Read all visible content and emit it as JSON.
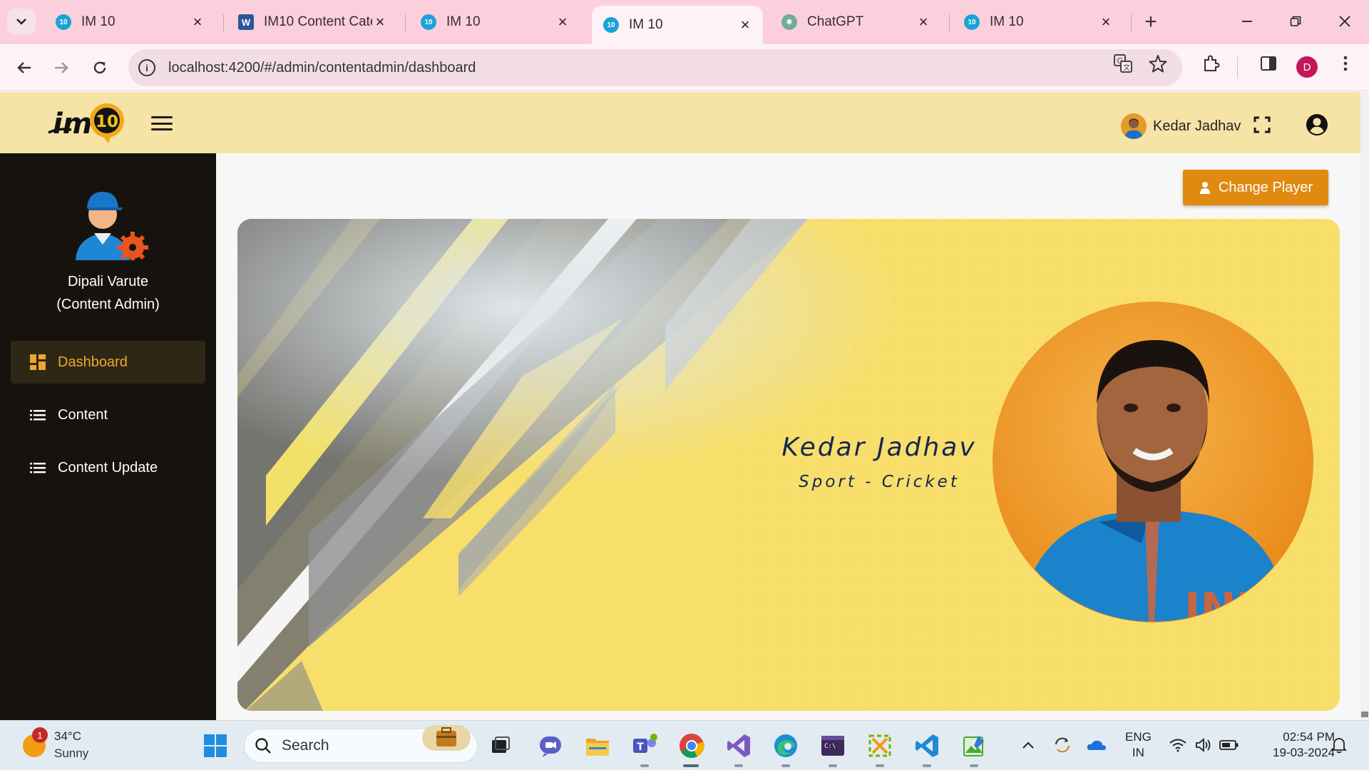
{
  "browser": {
    "tabs": [
      {
        "title": "IM 10",
        "favicon": "im10-icon",
        "active": false
      },
      {
        "title": "IM10 Content Cate",
        "favicon": "word-icon",
        "active": false
      },
      {
        "title": "IM 10",
        "favicon": "im10-icon",
        "active": false
      },
      {
        "title": "IM 10",
        "favicon": "im10-icon",
        "active": true
      },
      {
        "title": "ChatGPT",
        "favicon": "chatgpt-icon",
        "active": false
      },
      {
        "title": "IM 10",
        "favicon": "im10-icon",
        "active": false
      }
    ],
    "favicon_text": "10",
    "url": "localhost:4200/#/admin/contentadmin/dashboard",
    "profile_initial": "D"
  },
  "header": {
    "logo_text": "im",
    "logo_badge": "10",
    "user_name": "Kedar Jadhav"
  },
  "sidebar": {
    "admin_name": "Dipali Varute",
    "admin_role": "(Content Admin)",
    "items": [
      {
        "label": "Dashboard",
        "icon": "dashboard-icon",
        "active": true
      },
      {
        "label": "Content",
        "icon": "list-icon",
        "active": false
      },
      {
        "label": "Content Update",
        "icon": "list-icon",
        "active": false
      }
    ]
  },
  "main": {
    "change_player_label": "Change Player",
    "banner": {
      "player_name": "Kedar Jadhav",
      "sport_line": "Sport - Cricket",
      "jersey_text": "INDIA"
    }
  },
  "taskbar": {
    "weather_badge": "1",
    "temperature": "34°C",
    "condition": "Sunny",
    "search_label": "Search",
    "lang_line1": "ENG",
    "lang_line2": "IN",
    "time": "02:54 PM",
    "date": "19-03-2024"
  },
  "colors": {
    "header_bg": "#f6e3a6",
    "sidebar_bg": "#16130e",
    "accent": "#e08a12",
    "banner_yellow": "#f8de6a",
    "tabstrip_bg": "#fbd0dc"
  }
}
